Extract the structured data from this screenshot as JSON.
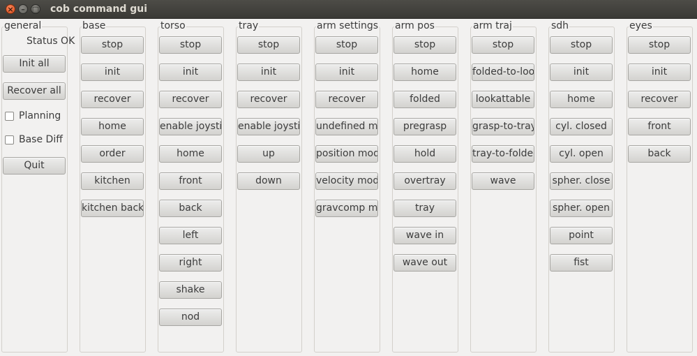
{
  "window": {
    "title": "cob command gui",
    "close_glyph": "×",
    "minimize_glyph": "–",
    "maximize_glyph": "□"
  },
  "general": {
    "title": "general",
    "status": "Status OK",
    "init_all": "Init all",
    "recover_all": "Recover all",
    "planning": "Planning",
    "base_diff": "Base Diff",
    "quit": "Quit"
  },
  "groups": [
    {
      "title": "base",
      "buttons": [
        "stop",
        "init",
        "recover",
        "home",
        "order",
        "kitchen",
        "kitchen back"
      ]
    },
    {
      "title": "torso",
      "buttons": [
        "stop",
        "init",
        "recover",
        "enable joystick",
        "home",
        "front",
        "back",
        "left",
        "right",
        "shake",
        "nod"
      ]
    },
    {
      "title": "tray",
      "buttons": [
        "stop",
        "init",
        "recover",
        "enable joystick",
        "up",
        "down"
      ]
    },
    {
      "title": "arm settings",
      "buttons": [
        "stop",
        "init",
        "recover",
        "undefined mode",
        "position mode",
        "velocity mode",
        "gravcomp mode"
      ]
    },
    {
      "title": "arm pos",
      "buttons": [
        "stop",
        "home",
        "folded",
        "pregrasp",
        "hold",
        "overtray",
        "tray",
        "wave in",
        "wave out"
      ]
    },
    {
      "title": "arm traj",
      "buttons": [
        "stop",
        "folded-to-lookattable",
        "lookattable",
        "grasp-to-tray",
        "tray-to-folded",
        "wave"
      ]
    },
    {
      "title": "sdh",
      "buttons": [
        "stop",
        "init",
        "home",
        "cyl. closed",
        "cyl. open",
        "spher. close",
        "spher. open",
        "point",
        "fist"
      ]
    },
    {
      "title": "eyes",
      "buttons": [
        "stop",
        "init",
        "recover",
        "front",
        "back"
      ]
    }
  ]
}
